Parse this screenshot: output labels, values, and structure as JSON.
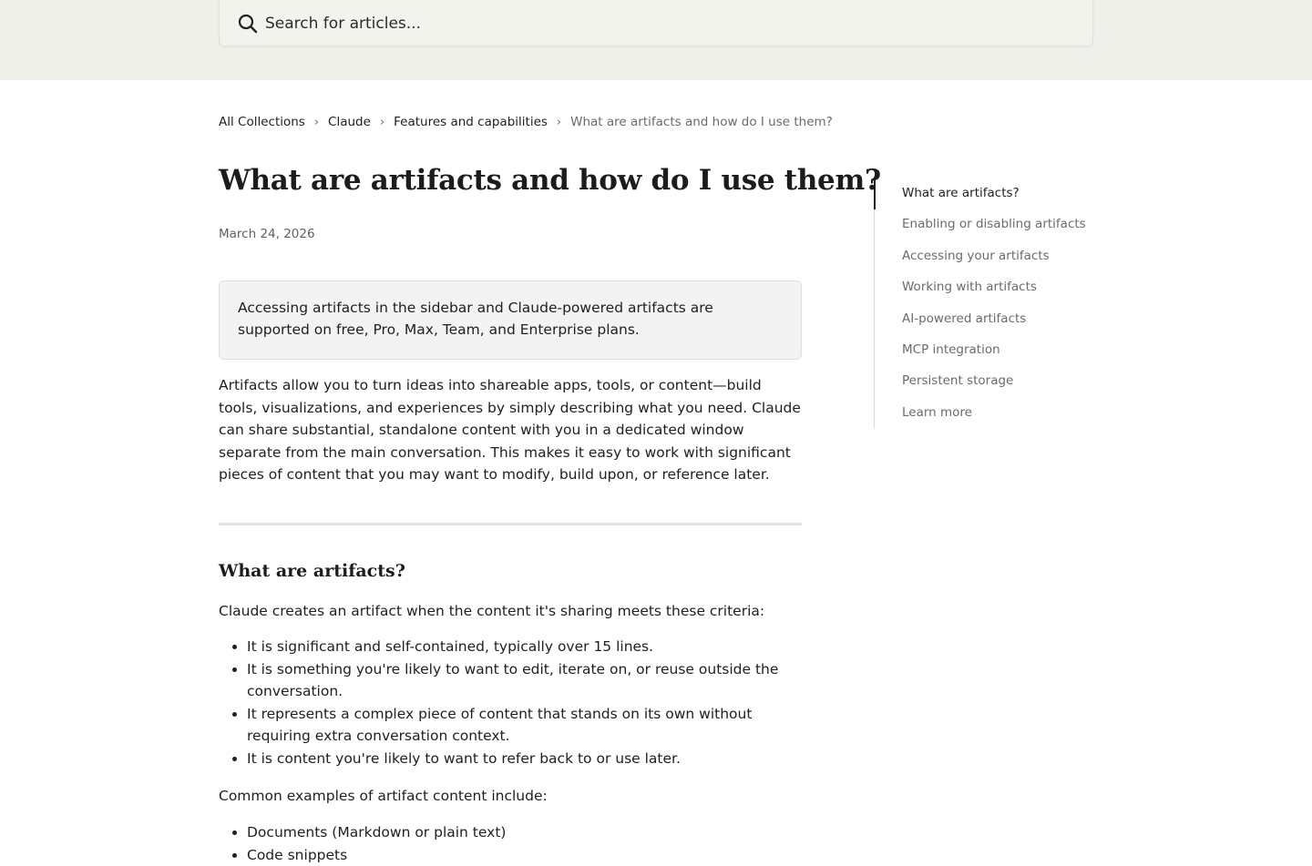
{
  "search": {
    "placeholder": "Search for articles..."
  },
  "breadcrumb": {
    "items": [
      "All Collections",
      "Claude",
      "Features and capabilities"
    ],
    "current": "What are artifacts and how do I use them?"
  },
  "article": {
    "title": "What are artifacts and how do I use them?",
    "date": "March 24, 2026",
    "callout": "Accessing artifacts in the sidebar and Claude-powered artifacts are supported on free, Pro, Max, Team, and Enterprise plans.",
    "intro": "Artifacts allow you to turn ideas into shareable apps, tools, or content—build tools, visualizations, and experiences by simply describing what you need. Claude can share substantial, standalone content with you in a dedicated window separate from the main conversation. This makes it easy to work with significant pieces of content that you may want to modify, build upon, or reference later.",
    "section1": {
      "heading": "What are artifacts?",
      "criteria_intro": "Claude creates an artifact when the content it's sharing meets these criteria:",
      "criteria": [
        "It is significant and self-contained, typically over 15 lines.",
        "It is something you're likely to want to edit, iterate on, or reuse outside the conversation.",
        "It represents a complex piece of content that stands on its own without requiring extra conversation context.",
        "It is content you're likely to want to refer back to or use later."
      ],
      "examples_intro": "Common examples of artifact content include:",
      "examples": [
        "Documents (Markdown or plain text)",
        "Code snippets"
      ]
    }
  },
  "toc": {
    "items": [
      "What are artifacts?",
      "Enabling or disabling artifacts",
      "Accessing your artifacts",
      "Working with artifacts",
      "AI-powered artifacts",
      "MCP integration",
      "Persistent storage",
      "Learn more"
    ],
    "active_index": 0
  },
  "colors": {
    "hero_bg": "#f0f0eb",
    "text": "#1f1f1f",
    "muted": "#6b6b6b"
  }
}
